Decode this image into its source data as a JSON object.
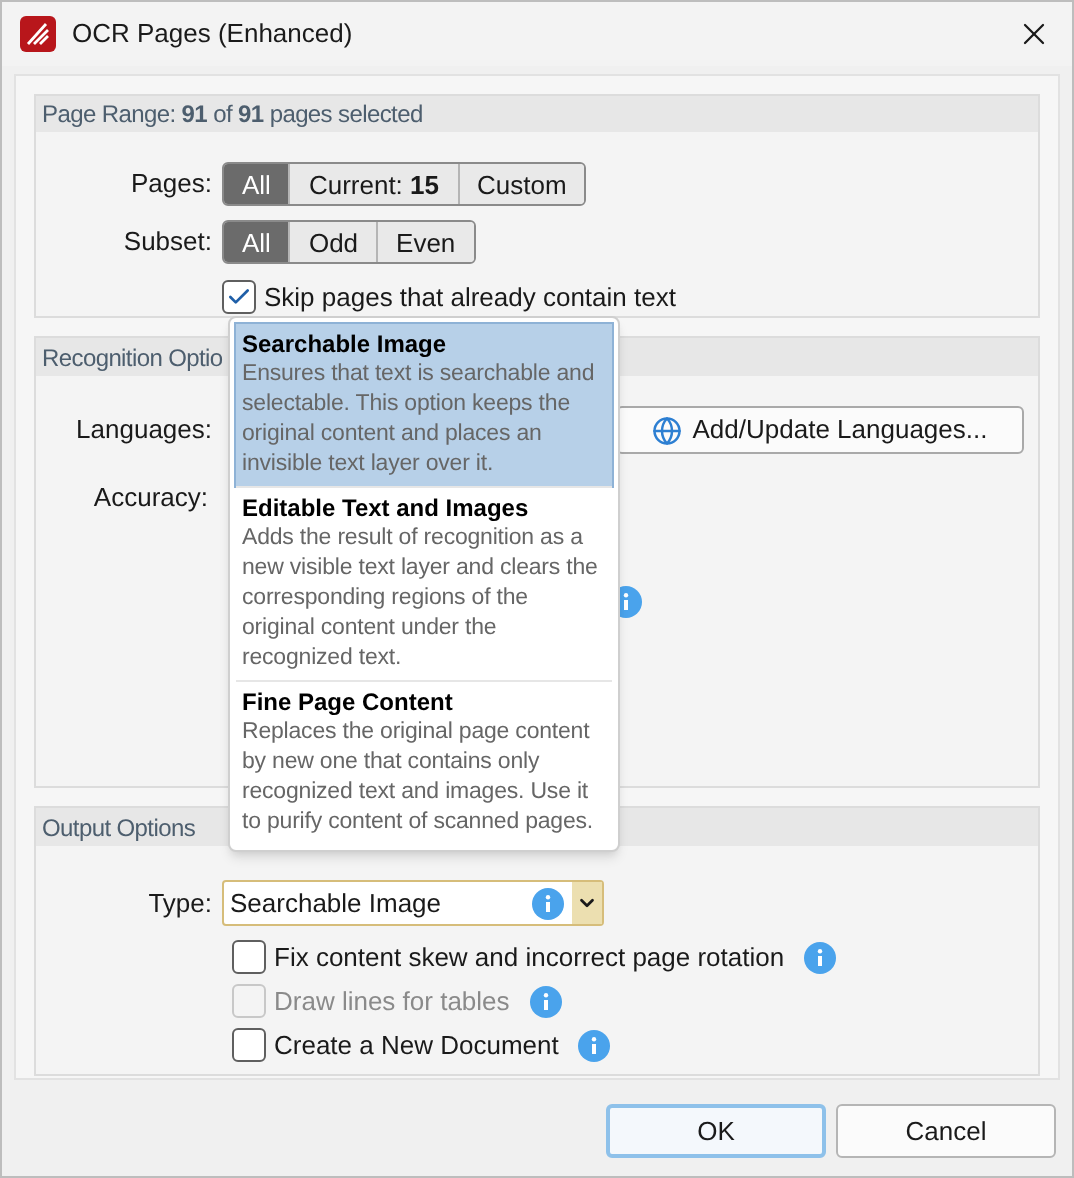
{
  "window": {
    "title": "OCR Pages (Enhanced)"
  },
  "page_range": {
    "title": "Page Range: **91** of **91** pages selected",
    "pages": {
      "label": "Pages:",
      "options": [
        {
          "label": "All",
          "selected": true
        },
        {
          "label": "Current: **15**",
          "selected": false
        },
        {
          "label": "Custom",
          "selected": false
        }
      ]
    },
    "subset": {
      "label": "Subset:",
      "options": [
        {
          "label": "All",
          "selected": true
        },
        {
          "label": "Odd",
          "selected": false
        },
        {
          "label": "Even",
          "selected": false
        }
      ]
    },
    "skip": {
      "label": "Skip pages that already contain text",
      "checked": true
    }
  },
  "recognition": {
    "title": "Recognition Optio",
    "languages_label": "Languages:",
    "add_languages_button": "Add/Update Languages...",
    "accuracy_label": "Accuracy:"
  },
  "output": {
    "title": "Output Options",
    "type_label": "Type:",
    "type_value": "Searchable Image",
    "options": [
      {
        "label": "Fix content skew and incorrect page rotation",
        "checked": false,
        "disabled": false
      },
      {
        "label": "Draw lines for tables",
        "checked": false,
        "disabled": true
      },
      {
        "label": "Create a New Document",
        "checked": false,
        "disabled": false
      }
    ]
  },
  "type_dropdown": {
    "items": [
      {
        "title": "Searchable Image",
        "description": "Ensures that text is searchable and selectable. This option keeps the original content and places an invisible text layer over it.",
        "selected": true
      },
      {
        "title": "Editable Text and Images",
        "description": "Adds the result of recognition as a new visible text layer and clears the corresponding regions of the original content under the recognized text.",
        "selected": false
      },
      {
        "title": "Fine Page Content",
        "description": "Replaces the original page content by new one that contains only recognized text and images. Use it to purify content of scanned pages.",
        "selected": false
      }
    ]
  },
  "buttons": [
    {
      "label": "OK",
      "default": true
    },
    {
      "label": "Cancel",
      "default": false
    }
  ]
}
